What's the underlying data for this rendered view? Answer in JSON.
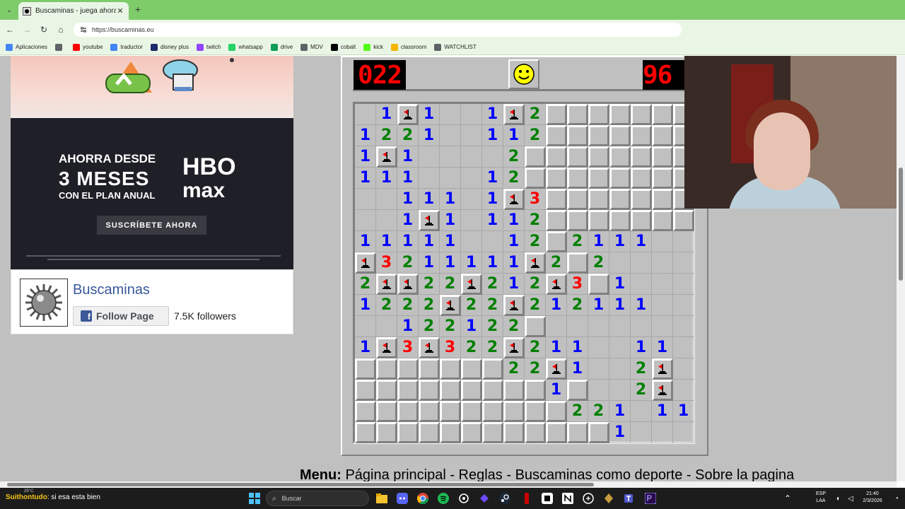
{
  "browser": {
    "tab_title": "Buscaminas - juega ahora!",
    "tab_close": "✕",
    "new_tab": "+",
    "url": "https://buscaminas.eu",
    "bookmarks": [
      {
        "label": "Aplicaciones",
        "color": "#4285f4"
      },
      {
        "label": "",
        "color": "#5f6368"
      },
      {
        "label": "youtube",
        "color": "#ff0000"
      },
      {
        "label": "traductor",
        "color": "#4285f4"
      },
      {
        "label": "disney plus",
        "color": "#1b2a6b"
      },
      {
        "label": "twitch",
        "color": "#9146ff"
      },
      {
        "label": "whatsapp",
        "color": "#25d366"
      },
      {
        "label": "drive",
        "color": "#0f9d58"
      },
      {
        "label": "MDV",
        "color": "#5f6368"
      },
      {
        "label": "cobalt",
        "color": "#000000"
      },
      {
        "label": "kick",
        "color": "#53fc18"
      },
      {
        "label": "classroom",
        "color": "#f4b400"
      },
      {
        "label": "WATCHLIST",
        "color": "#5f6368"
      }
    ]
  },
  "ad": {
    "line1": "AHORRA DESDE",
    "line2": "3 MESES",
    "line3": "CON EL PLAN ANUAL",
    "brand1": "HBO",
    "brand2": "max",
    "cta": "SUSCRÍBETE AHORA"
  },
  "fb": {
    "name": "Buscaminas",
    "follow": "Follow Page",
    "followers": "7.5K followers"
  },
  "game": {
    "mines_counter": "022",
    "timer": "96",
    "grid": [
      "_1F1__1F2CCCCCCC",
      "1221__112CCCCCCC",
      "1F1____2CCCCCCCC",
      "111___12CCCCCCCC",
      "__111_1F3CCCCCCC",
      "__1F1_112CCCCCCC",
      "11111__12C2111__",
      "F3211111F2C2____",
      "2FF22F212F3C1___",
      "1222F22F212111__",
      "__122122C_______",
      "1F3F322F211__11_",
      "CCCCCCC22F1__2F_",
      "CCCCCCCCC1C__2F_",
      "CCCCCCCCCC221_11",
      "CCCCCCCCCCCC1___"
    ]
  },
  "menu": {
    "label": "Menu:",
    "links": "Página principal - Reglas - Buscaminas como deporte - Sobre la pagina"
  },
  "taskbar": {
    "temp": "25°C",
    "chat_user": "Suithontudo",
    "chat_message": ": si esa esta bien",
    "search_placeholder": "Buscar",
    "lang_top": "ESP",
    "lang_bottom": "LAA",
    "time": "21:40",
    "date": "2/3/2026"
  }
}
